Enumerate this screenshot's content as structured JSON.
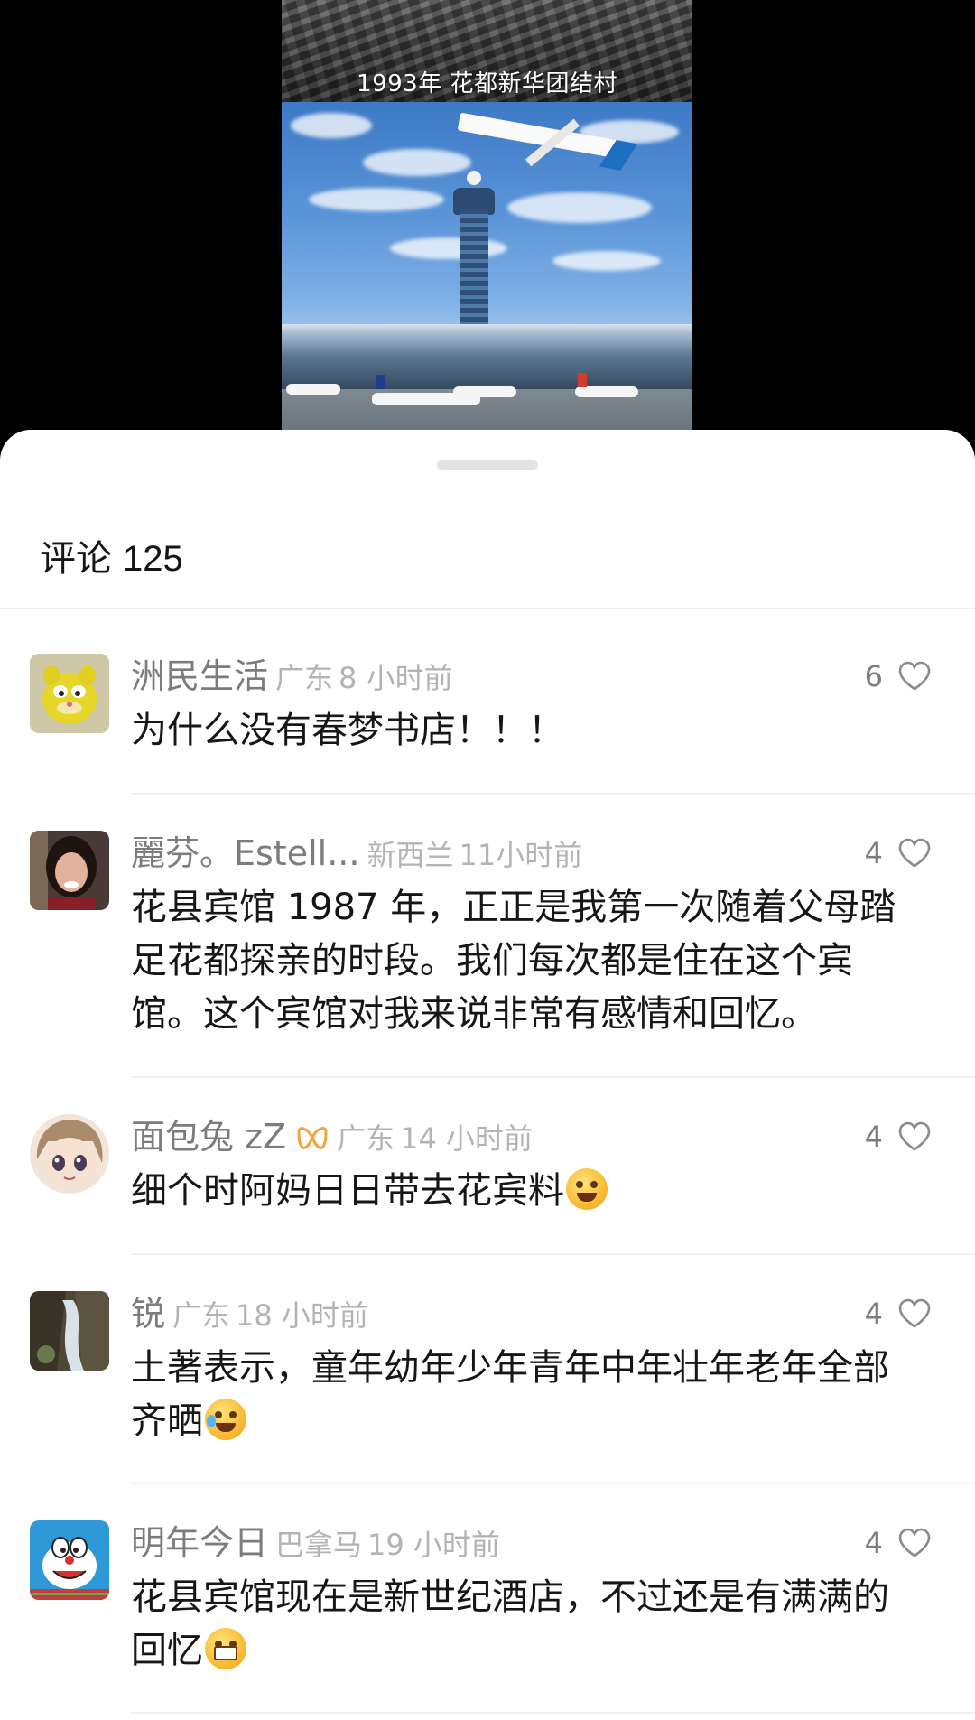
{
  "video": {
    "caption": "1993年 花都新华团结村"
  },
  "sheet": {
    "title": "评论",
    "count": "125"
  },
  "comments": [
    {
      "username": "洲民生活",
      "location": "广东",
      "time": "8 小时前",
      "likes": "6",
      "text": "为什么没有春梦书店！！！",
      "avatar_icon": "garfield-avatar"
    },
    {
      "username": "麗芬。Estell...",
      "location": "新西兰",
      "time": "11小时前",
      "likes": "4",
      "text": "花县宾馆 1987 年，正正是我第一次随着父母踏足花都探亲的时段。我们每次都是住在这个宾馆。这个宾馆对我来说非常有感情和回忆。",
      "avatar_icon": "photo-avatar"
    },
    {
      "username": "面包兔 zZ",
      "location": "广东",
      "time": "14 小时前",
      "likes": "4",
      "text": "细个时阿妈日日带去花宾料",
      "emoji": "sweat-face-emoji",
      "badge_icon": "orange-bow-icon",
      "avatar_icon": "anime-avatar"
    },
    {
      "username": "锐",
      "location": "广东",
      "time": "18 小时前",
      "likes": "4",
      "text": "土著表示，童年幼年少年青年中年壮年老年全部齐晒",
      "emoji": "laughing-crying-emoji",
      "avatar_icon": "waterfall-avatar"
    },
    {
      "username": "明年今日",
      "location": "巴拿马",
      "time": "19 小时前",
      "likes": "4",
      "text": "花县宾馆现在是新世纪酒店，不过还是有满满的回忆",
      "emoji": "grinning-emoji",
      "avatar_icon": "doraemon-avatar"
    }
  ],
  "colors": {
    "background": "#000000",
    "sheet": "#ffffff",
    "username": "#7c7c7c",
    "meta": "#b3b3b3",
    "text": "#161616",
    "badge": "#f2a33a"
  }
}
